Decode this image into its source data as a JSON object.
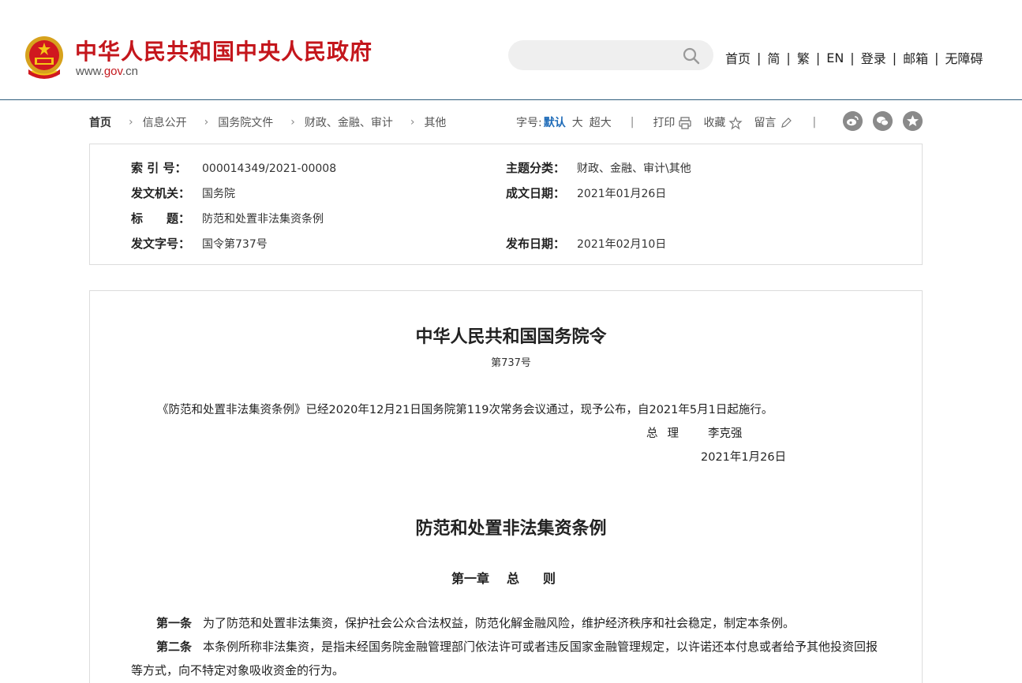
{
  "header": {
    "site_title": "中华人民共和国中央人民政府",
    "domain_prefix": "www.",
    "domain_gov": "gov",
    "domain_suffix": ".cn",
    "search_placeholder": "",
    "nav": [
      "首页",
      "简",
      "繁",
      "EN",
      "登录",
      "邮箱",
      "无障碍"
    ],
    "nav_separator": "|",
    "brand_color": "#c4161c"
  },
  "breadcrumb": {
    "items": [
      "首页",
      "信息公开",
      "国务院文件",
      "财政、金融、审计",
      "其他"
    ]
  },
  "tools": {
    "font_size_label": "字号:",
    "font_sizes": [
      "默认",
      "大",
      "超大"
    ],
    "separator": "|",
    "print_label": "打印",
    "favorite_label": "收藏",
    "comment_label": "留言",
    "share_icons": [
      "weibo-icon",
      "wechat-icon",
      "qzone-icon"
    ]
  },
  "info": {
    "index_no_label": "索 引 号：",
    "index_no": "000014349/2021-00008",
    "topic_label": "主题分类：",
    "topic": "财政、金融、审计\\其他",
    "issuer_label": "发文机关：",
    "issuer": "国务院",
    "written_date_label": "成文日期：",
    "written_date": "2021年01月26日",
    "title_label": "标　　题：",
    "title": "防范和处置非法集资条例",
    "doc_no_label": "发文字号：",
    "doc_no": "国令第737号",
    "publish_date_label": "发布日期：",
    "publish_date": "2021年02月10日"
  },
  "document": {
    "order_title": "中华人民共和国国务院令",
    "order_number": "第737号",
    "promulgation": "《防范和处置非法集资条例》已经2020年12月21日国务院第119次常务会议通过，现予公布，自2021年5月1日起施行。",
    "signer_role": "总理",
    "signer_name": "李克强",
    "sign_date": "2021年1月26日",
    "regulation_title": "防范和处置非法集资条例",
    "chapter_no": "第一章",
    "chapter_name": "总则",
    "articles": [
      {
        "no": "第一条",
        "text": "为了防范和处置非法集资，保护社会公众合法权益，防范化解金融风险，维护经济秩序和社会稳定，制定本条例。"
      },
      {
        "no": "第二条",
        "text": "本条例所称非法集资，是指未经国务院金融管理部门依法许可或者违反国家金融管理规定，以许诺还本付息或者给予其他投资回报等方式，向不特定对象吸收资金的行为。"
      }
    ]
  }
}
